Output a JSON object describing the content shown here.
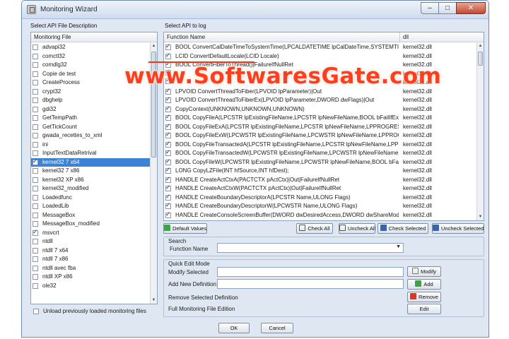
{
  "window": {
    "title": "Monitoring Wizard"
  },
  "title_buttons": {
    "minimize": "–",
    "maximize": "□",
    "close": "✕"
  },
  "left_panel": {
    "group_label": "Select API File Description",
    "header": "Monitoring File",
    "items": [
      {
        "label": "advapi32",
        "checked": false,
        "selected": false
      },
      {
        "label": "comctl32",
        "checked": false,
        "selected": false
      },
      {
        "label": "comdlg32",
        "checked": false,
        "selected": false
      },
      {
        "label": "Copie de test",
        "checked": false,
        "selected": false
      },
      {
        "label": "CreateProcess",
        "checked": false,
        "selected": false
      },
      {
        "label": "crypt32",
        "checked": false,
        "selected": false
      },
      {
        "label": "dbghelp",
        "checked": false,
        "selected": false
      },
      {
        "label": "gdi32",
        "checked": false,
        "selected": false
      },
      {
        "label": "GetTempPath",
        "checked": false,
        "selected": false
      },
      {
        "label": "GetTickCount",
        "checked": false,
        "selected": false
      },
      {
        "label": "gwada_recettes_to_xml",
        "checked": false,
        "selected": false
      },
      {
        "label": "ini",
        "checked": false,
        "selected": false
      },
      {
        "label": "InputTextDataRetrival",
        "checked": false,
        "selected": false
      },
      {
        "label": "kernel32 7 x64",
        "checked": true,
        "selected": true
      },
      {
        "label": "kernel32 7 x86",
        "checked": false,
        "selected": false
      },
      {
        "label": "kernel32 XP x86",
        "checked": false,
        "selected": false
      },
      {
        "label": "kernel32_modified",
        "checked": false,
        "selected": false
      },
      {
        "label": "Loadedfunc",
        "checked": false,
        "selected": false
      },
      {
        "label": "LoadedLib",
        "checked": false,
        "selected": false
      },
      {
        "label": "MessageBox",
        "checked": false,
        "selected": false
      },
      {
        "label": "MessageBox_modified",
        "checked": false,
        "selected": false
      },
      {
        "label": "msvcrt",
        "checked": true,
        "selected": false
      },
      {
        "label": "ntdll",
        "checked": false,
        "selected": false
      },
      {
        "label": "ntdll 7 x64",
        "checked": false,
        "selected": false
      },
      {
        "label": "ntdll 7 x86",
        "checked": false,
        "selected": false
      },
      {
        "label": "ntdll avec fba",
        "checked": false,
        "selected": false
      },
      {
        "label": "ntdll XP x86",
        "checked": false,
        "selected": false
      },
      {
        "label": "ole32",
        "checked": false,
        "selected": false
      }
    ],
    "unload_label": "Unload previously loaded monitoring files"
  },
  "right_panel": {
    "group_label": "Select API to log",
    "columns": [
      "Function Name",
      "dll"
    ],
    "rows": [
      {
        "fn": "BOOL ConvertCalDateTimeToSystemTime(LPCALDATETIME lpCalDateTime,SYSTEMTIME* lpSysTime)|...",
        "dll": "kernel32.dll",
        "checked": true
      },
      {
        "fn": "LCID ConvertDefaultLocale(LCID Locale)",
        "dll": "kernel32.dll",
        "checked": true
      },
      {
        "fn": "BOOL ConvertFiberToThread()|FailureIfNullRet",
        "dll": "kernel32.dll",
        "checked": true
      },
      {
        "fn": "",
        "dll": "kernel32.dll",
        "checked": true
      },
      {
        "fn": "",
        "dll": "kernel32.dll",
        "checked": true
      },
      {
        "fn": "LPVOID ConvertThreadToFiber(LPVOID lpParameter)|Out",
        "dll": "kernel32.dll",
        "checked": true
      },
      {
        "fn": "LPVOID ConvertThreadToFiberEx(LPVOID lpParameter,DWORD dwFlags)|Out",
        "dll": "kernel32.dll",
        "checked": true
      },
      {
        "fn": "CopyContext(UNKNOWN,UNKNOWN,UNKNOWN)",
        "dll": "kernel32.dll",
        "checked": true
      },
      {
        "fn": "BOOL CopyFileA(LPCSTR lpExistingFileName,LPCSTR lpNewFileName,BOOL bFailIfExists)|FailureIfNullRet",
        "dll": "kernel32.dll",
        "checked": true
      },
      {
        "fn": "BOOL CopyFileExA(LPCSTR lpExistingFileName,LPCSTR lpNewFileName,LPPROGRESS_ROUTINE lpProgre...",
        "dll": "kernel32.dll",
        "checked": true
      },
      {
        "fn": "BOOL CopyFileExW(LPCWSTR lpExistingFileName,LPCWSTR lpNewFileName,LPPROGRESS_ROUTINE ...",
        "dll": "kernel32.dll",
        "checked": true
      },
      {
        "fn": "BOOL CopyFileTransactedA(LPCSTR lpExistingFileName,LPCSTR lpNewFileName,LPPROGRESS_ROUT...",
        "dll": "kernel32.dll",
        "checked": true
      },
      {
        "fn": "BOOL CopyFileTransactedW(LPCWSTR lpExistingFileName,LPCWSTR lpNewFileName,LPPROGRESS_R...",
        "dll": "kernel32.dll",
        "checked": true
      },
      {
        "fn": "BOOL CopyFileW(LPCWSTR lpExistingFileName,LPCWSTR lpNewFileName,BOOL bFailIfExists)|Failure...",
        "dll": "kernel32.dll",
        "checked": true
      },
      {
        "fn": "LONG CopyLZFile(INT hfSource,INT hfDest);",
        "dll": "kernel32.dll",
        "checked": true
      },
      {
        "fn": "HANDLE CreateActCtxA(PACTCTX pActCtx)|Out|FailureIfNullRet",
        "dll": "kernel32.dll",
        "checked": true
      },
      {
        "fn": "HANDLE CreateActCtxW(PACTCTX pActCtx)|Out|FailureIfNullRet",
        "dll": "kernel32.dll",
        "checked": true
      },
      {
        "fn": "HANDLE CreateBoundaryDescriptorA(LPCSTR Name,ULONG Flags)",
        "dll": "kernel32.dll",
        "checked": true
      },
      {
        "fn": "HANDLE CreateBoundaryDescriptorW(LPCWSTR Name,ULONG Flags)",
        "dll": "kernel32.dll",
        "checked": true
      },
      {
        "fn": "HANDLE CreateConsoleScreenBuffer(DWORD dwDesiredAccess,DWORD dwShareMode,const SECU...",
        "dll": "kernel32.dll",
        "checked": true
      }
    ]
  },
  "buttons": {
    "default_values": "Default Values",
    "check_all": "Check All",
    "uncheck_all": "Uncheck All",
    "check_selected": "Check Selected",
    "uncheck_selected": "Uncheck Selected",
    "modify": "Modify",
    "add": "Add",
    "remove": "Remove",
    "edit": "Edit",
    "ok": "OK",
    "cancel": "Cancel"
  },
  "search": {
    "section_label": "Search",
    "field_label": "Function Name",
    "value": ""
  },
  "quick_edit": {
    "section_label": "Quick Edit Mode",
    "modify_label": "Modify Selected",
    "add_label": "Add New Definition",
    "remove_label": "Remove Selected Definition",
    "full_label": "Full Monitoring File Edition"
  },
  "watermark": "www.SoftwaresGate.com",
  "colors": {
    "selection": "#3e82d6",
    "watermark": "#ff3d1f",
    "window_bg": "#dfe7f2"
  }
}
